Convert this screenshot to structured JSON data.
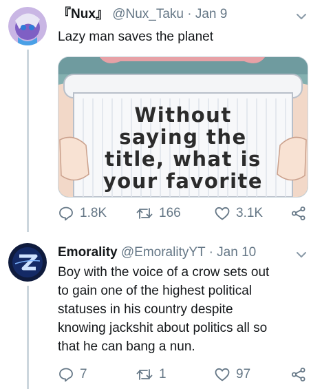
{
  "tweets": [
    {
      "display_name": "『Nux』",
      "handle": "@Nux_Taku",
      "separator": "·",
      "date": "Jan 9",
      "text": "Lazy man saves the planet",
      "media_text": [
        "Without",
        "saying the",
        "title, what is",
        "your favorite"
      ],
      "replies": "1.8K",
      "retweets": "166",
      "likes": "3.1K"
    },
    {
      "display_name": "Emorality",
      "handle": "@EmoralityYT",
      "separator": "·",
      "date": "Jan 10",
      "text_lines": [
        "Boy with the voice of a crow sets out",
        "to gain one of the highest political",
        "statuses in his country despite",
        "knowing jackshit about politics all so",
        "that he can bang a nun."
      ],
      "replies": "7",
      "retweets": "1",
      "likes": "97"
    }
  ],
  "colors": {
    "text": "#14171a",
    "secondary": "#657786",
    "thread_line": "#ccd6dd"
  },
  "icons": [
    "reply-icon",
    "retweet-icon",
    "like-icon",
    "share-icon",
    "chevron-down-icon"
  ]
}
